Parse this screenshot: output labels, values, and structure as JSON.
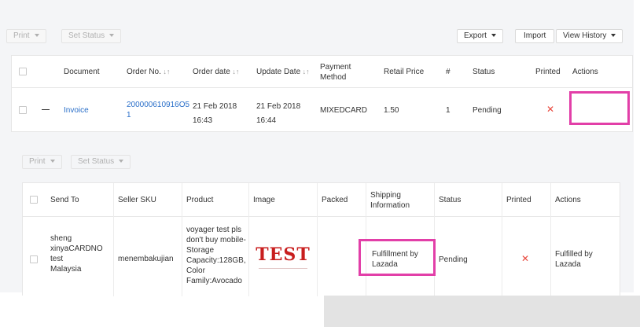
{
  "toolbar": {
    "print_label": "Print",
    "set_status_label": "Set Status",
    "export_label": "Export",
    "import_label": "Import",
    "view_history_label": "View History"
  },
  "orders_table": {
    "headers": [
      "Document",
      "Order No.",
      "Order date",
      "Update Date",
      "Payment Method",
      "Retail Price",
      "#",
      "Status",
      "Printed",
      "Actions"
    ],
    "row": {
      "collapse": "—",
      "document": "Invoice",
      "order_no_line1": "200000610916O5",
      "order_no_line2": "1",
      "order_date_line1": "21 Feb 2018",
      "order_date_line2": "16:43",
      "update_date_line1": "21 Feb 2018",
      "update_date_line2": "16:44",
      "payment_method": "MIXEDCARD",
      "retail_price": "1.50",
      "count": "1",
      "status": "Pending",
      "printed": "✕"
    }
  },
  "sub_toolbar": {
    "print_label": "Print",
    "set_status_label": "Set Status"
  },
  "items_table": {
    "headers": [
      "Send To",
      "Seller SKU",
      "Product",
      "Image",
      "Packed",
      "Shipping Information",
      "Status",
      "Printed",
      "Actions"
    ],
    "row": {
      "send_to": [
        "sheng",
        "xinyaCARDNO",
        "test",
        "Malaysia"
      ],
      "seller_sku": "menembakujian",
      "product": [
        "voyager test pls",
        "don't buy mobile-",
        "Storage",
        "Capacity:128GB,",
        "Color",
        "Family:Avocado"
      ],
      "image_text": "TEST",
      "shipping_info": [
        "Fulfillment by",
        "Lazada"
      ],
      "status": "Pending",
      "printed": "✕",
      "actions": [
        "Fulfilled by",
        "Lazada"
      ]
    }
  },
  "colors": {
    "link": "#2a6fc9",
    "highlight": "#e23fa8",
    "printed_x": "#e8473c"
  }
}
